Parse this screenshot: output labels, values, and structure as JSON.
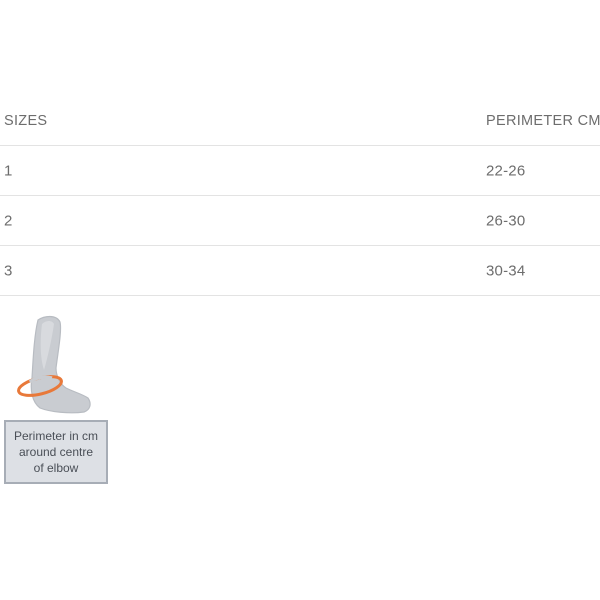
{
  "table": {
    "headers": {
      "size": "SIZES",
      "perimeter": "PERIMETER CM"
    },
    "rows": [
      {
        "size": "1",
        "perimeter": "22-26"
      },
      {
        "size": "2",
        "perimeter": "26-30"
      },
      {
        "size": "3",
        "perimeter": "30-34"
      }
    ]
  },
  "illustration": {
    "icon": "elbow-arm-icon",
    "caption_lines": [
      "Perimeter in cm",
      "around centre",
      "of elbow"
    ],
    "colors": {
      "arm_fill": "#c9ccd1",
      "arm_outline": "#b8bcc2",
      "measure_ring": "#e8793a",
      "caption_bg": "#dde0e5",
      "caption_border": "#a7adb6"
    }
  }
}
